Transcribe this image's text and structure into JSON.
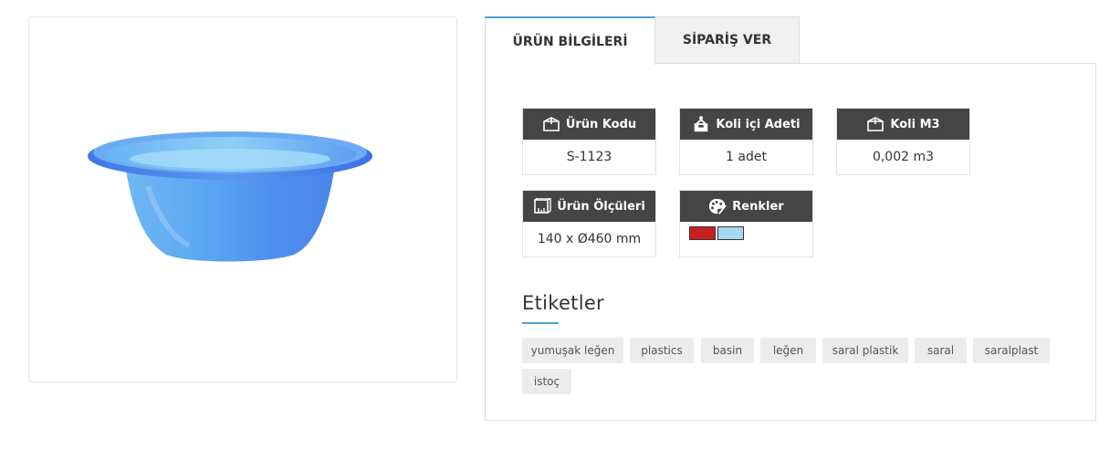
{
  "tabs": {
    "info": "ÜRÜN BİLGİLERİ",
    "order": "SİPARİŞ VER"
  },
  "product_info": {
    "code": {
      "label": "Ürün Kodu",
      "value": "S-1123",
      "icon": "box-icon"
    },
    "pieces": {
      "label": "Koli içi Adeti",
      "value": "1 adet",
      "icon": "box-person-icon"
    },
    "volume": {
      "label": "Koli M3",
      "value": "0,002 m3",
      "icon": "box-icon"
    },
    "size": {
      "label": "Ürün Ölçüleri",
      "value": "140 x Ø460 mm",
      "icon": "ruler-box-icon"
    },
    "colors": {
      "label": "Renkler",
      "icon": "palette-icon",
      "swatches": [
        "#c9201f",
        "#a8d8ee"
      ]
    }
  },
  "tags": {
    "title": "Etiketler",
    "items": [
      "yumuşak leğen",
      "plastics",
      "basin",
      "leğen",
      "saral plastik",
      "saral",
      "saralplast",
      "istoç"
    ]
  },
  "colors": {
    "accent": "#4aa3d1",
    "header_bg": "#454545",
    "tag_bg": "#ececec",
    "bowl": "#5aa2ee"
  }
}
